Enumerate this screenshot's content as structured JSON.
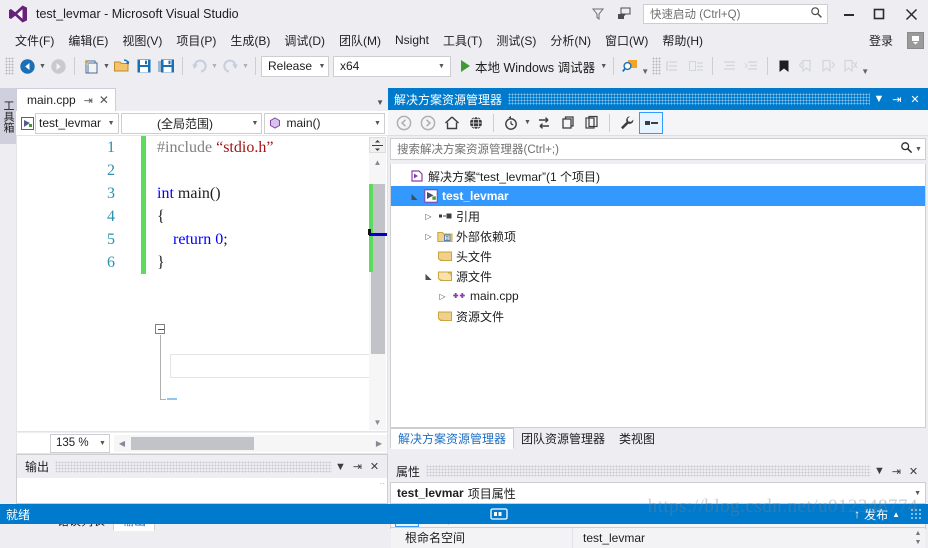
{
  "titlebar": {
    "title": "test_levmar - Microsoft Visual Studio",
    "logo_icon": "visual-studio-logo-icon",
    "filter_icon": "funnel-icon",
    "feedback_icon": "feedback-smiley-icon",
    "quick_launch_placeholder": "快速启动 (Ctrl+Q)",
    "quick_launch_value": "",
    "search_icon": "magnifier-icon",
    "minimize": "—",
    "maximize": "❐",
    "close": "✕"
  },
  "menubar": {
    "items": [
      {
        "label": "文件(F)",
        "accel": "F"
      },
      {
        "label": "编辑(E)",
        "accel": "E"
      },
      {
        "label": "视图(V)",
        "accel": "V"
      },
      {
        "label": "项目(P)",
        "accel": "P"
      },
      {
        "label": "生成(B)",
        "accel": "B"
      },
      {
        "label": "调试(D)",
        "accel": "D"
      },
      {
        "label": "团队(M)",
        "accel": "M"
      },
      {
        "label": "Nsight",
        "accel": "N"
      },
      {
        "label": "工具(T)",
        "accel": "T"
      },
      {
        "label": "测试(S)",
        "accel": "S"
      },
      {
        "label": "分析(N)",
        "accel": "N"
      },
      {
        "label": "窗口(W)",
        "accel": "W"
      },
      {
        "label": "帮助(H)",
        "accel": "H"
      }
    ],
    "signin_label": "登录",
    "feedback_icon": "send-feedback-icon"
  },
  "toolbar": {
    "back_icon": "navigate-back-icon",
    "forward_icon": "navigate-forward-icon",
    "new_project_icon": "new-project-icon",
    "open_file_icon": "open-file-icon",
    "save_icon": "save-icon",
    "save_all_icon": "save-all-icon",
    "undo_icon": "undo-icon",
    "redo_icon": "redo-icon",
    "configuration": "Release",
    "platform": "x64",
    "run_label": "本地 Windows 调试器",
    "run_icon": "play-triangle-icon",
    "find_icon": "find-in-files-icon",
    "step_icons": [
      "step-into-icon",
      "step-over-icon"
    ],
    "indent_icons": [
      "decrease-indent-icon",
      "increase-indent-icon"
    ],
    "bookmark_icon": "bookmark-icon",
    "bookmark_nav_icons": [
      "previous-bookmark-icon",
      "next-bookmark-icon",
      "clear-bookmarks-icon"
    ],
    "overflow_icon": "toolbar-overflow-icon"
  },
  "toolbox_tab": {
    "label": "工具箱"
  },
  "editor": {
    "tab_label": "main.cpp",
    "tab_pin_icon": "pin-icon",
    "tab_close_icon": "close-icon",
    "tab_list_icon": "tab-list-chevron-icon",
    "nav_project": "test_levmar",
    "nav_project_icon": "cpp-project-icon",
    "nav_scope": "(全局范围)",
    "nav_member": "main()",
    "nav_member_icon": "method-icon",
    "zoom_level": "135 %",
    "lines": [
      {
        "n": "1",
        "changed": true,
        "code": "#include “stdio.h”",
        "tokens": [
          {
            "t": "#include",
            "c": "pp"
          },
          {
            "t": " ",
            "c": "ty"
          },
          {
            "t": "“stdio.h”",
            "c": "str"
          }
        ]
      },
      {
        "n": "2",
        "changed": true,
        "code": "",
        "tokens": []
      },
      {
        "n": "3",
        "changed": true,
        "code": "int main()",
        "tokens": [
          {
            "t": "int",
            "c": "kw"
          },
          {
            "t": " main()",
            "c": "ty"
          }
        ]
      },
      {
        "n": "4",
        "changed": true,
        "code": "{",
        "tokens": [
          {
            "t": "{",
            "c": "ty"
          }
        ]
      },
      {
        "n": "5",
        "changed": true,
        "code": "    return 0;",
        "tokens": [
          {
            "t": "    ",
            "c": "ty"
          },
          {
            "t": "return",
            "c": "kw"
          },
          {
            "t": " ",
            "c": "ty"
          },
          {
            "t": "0",
            "c": "num"
          },
          {
            "t": ";",
            "c": "ty"
          }
        ]
      },
      {
        "n": "6",
        "changed": true,
        "code": "}",
        "tokens": [
          {
            "t": "}",
            "c": "ty"
          }
        ]
      }
    ],
    "split_icon": "split-editor-icon",
    "scroll_up_icon": "scroll-up-icon",
    "scroll_down_icon": "scroll-down-icon",
    "hscroll_left_icon": "scroll-left-icon",
    "hscroll_right_icon": "scroll-right-icon"
  },
  "output_panel": {
    "title": "输出",
    "dropdown_icon": "window-menu-icon",
    "pin_icon": "pin-icon",
    "close_icon": "close-icon",
    "content": ""
  },
  "bottom_tabs": [
    {
      "label": "错误列表",
      "active": false
    },
    {
      "label": "输出",
      "active": true
    }
  ],
  "solution_explorer": {
    "title": "解决方案资源管理器",
    "dropdown_icon": "window-menu-icon",
    "pin_icon": "pin-icon",
    "close_icon": "close-icon",
    "toolbar_icons": [
      "navigate-back-icon",
      "navigate-forward-icon",
      "home-icon",
      "globe-all-files-icon",
      "pending-changes-icon",
      "sync-with-active-document-icon",
      "refresh-icon",
      "show-all-files-icon",
      "properties-wrench-icon",
      "collapse-all-icon"
    ],
    "search_placeholder": "搜索解决方案资源管理器(Ctrl+;)",
    "search_value": "",
    "search_icon": "magnifier-icon",
    "tree": [
      {
        "label": "解决方案“test_levmar”(1 个项目)",
        "indent": 0,
        "twisty": "",
        "icon": "solution-icon",
        "selected": false
      },
      {
        "label": "test_levmar",
        "indent": 1,
        "twisty": "expanded",
        "icon": "cpp-project-icon",
        "selected": true
      },
      {
        "label": "引用",
        "indent": 2,
        "twisty": "collapsed",
        "icon": "references-icon",
        "selected": false
      },
      {
        "label": "外部依赖项",
        "indent": 2,
        "twisty": "collapsed",
        "icon": "folder-deps-icon",
        "selected": false
      },
      {
        "label": "头文件",
        "indent": 2,
        "twisty": "",
        "icon": "filter-folder-icon",
        "selected": false
      },
      {
        "label": "源文件",
        "indent": 2,
        "twisty": "expanded",
        "icon": "filter-folder-open-icon",
        "selected": false
      },
      {
        "label": "main.cpp",
        "indent": 3,
        "twisty": "collapsed",
        "icon": "cpp-file-icon",
        "selected": false
      },
      {
        "label": "资源文件",
        "indent": 2,
        "twisty": "",
        "icon": "filter-folder-icon",
        "selected": false
      }
    ],
    "tabs": [
      {
        "label": "解决方案资源管理器",
        "active": true
      },
      {
        "label": "团队资源管理器",
        "active": false
      },
      {
        "label": "类视图",
        "active": false
      }
    ]
  },
  "properties_panel": {
    "title": "属性",
    "dropdown_icon": "window-menu-icon",
    "pin_icon": "pin-icon",
    "close_icon": "close-icon",
    "selected_object": "test_levmar",
    "selected_kind": "项目属性",
    "selector_arrow_icon": "chevron-down-icon",
    "toolbar_icons": [
      "categorized-view-icon",
      "alphabetical-sort-icon",
      "property-pages-wrench-icon"
    ],
    "rows": [
      {
        "key": "根命名空间",
        "value": "test_levmar"
      }
    ],
    "spinner_icon": "spinner-updown-icon"
  },
  "statusbar": {
    "status": "就绪",
    "indicator_icon": "source-control-indicator-icon",
    "publish_label": "发布",
    "publish_up_icon": "arrow-up-icon",
    "publish_caret_icon": "caret-up-icon",
    "resize_grip_icon": "resize-grip-icon"
  },
  "watermark": {
    "text": "https://blog.csdn.net/u012348774"
  }
}
